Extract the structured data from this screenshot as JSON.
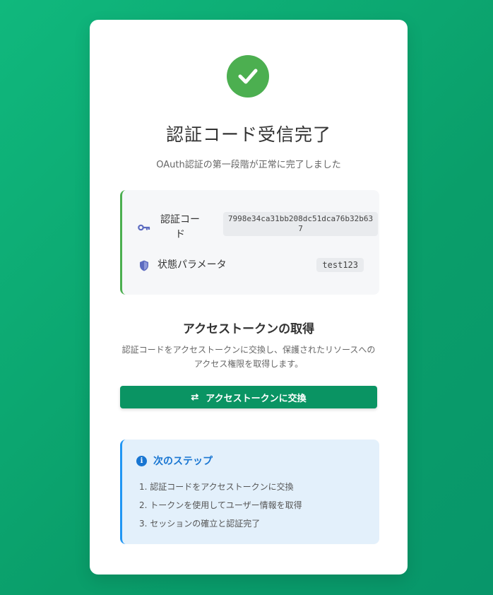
{
  "header": {
    "title": "認証コード受信完了",
    "subtitle": "OAuth認証の第一段階が正常に完了しました",
    "status_icon": "check-circle-icon",
    "status_color": "#4caf50"
  },
  "details": {
    "code_label": "認証コード",
    "code_value": "7998e34ca31bb208dc51dca76b32b637",
    "code_icon": "key-icon",
    "state_label": "状態パラメータ",
    "state_value": "test123",
    "state_icon": "shield-icon",
    "accent_color": "#4caf50"
  },
  "token_section": {
    "title": "アクセストークンの取得",
    "description": "認証コードをアクセストークンに交換し、保護されたリソースへのアクセス権限を取得します。",
    "button_label": "アクセストークンに交換",
    "button_icon": "exchange-icon",
    "button_color": "#0a9463"
  },
  "next_steps": {
    "title": "次のステップ",
    "icon": "info-icon",
    "accent_color": "#1976d2",
    "items": [
      "1. 認証コードをアクセストークンに交換",
      "2. トークンを使用してユーザー情報を取得",
      "3. セッションの確立と認証完了"
    ]
  }
}
